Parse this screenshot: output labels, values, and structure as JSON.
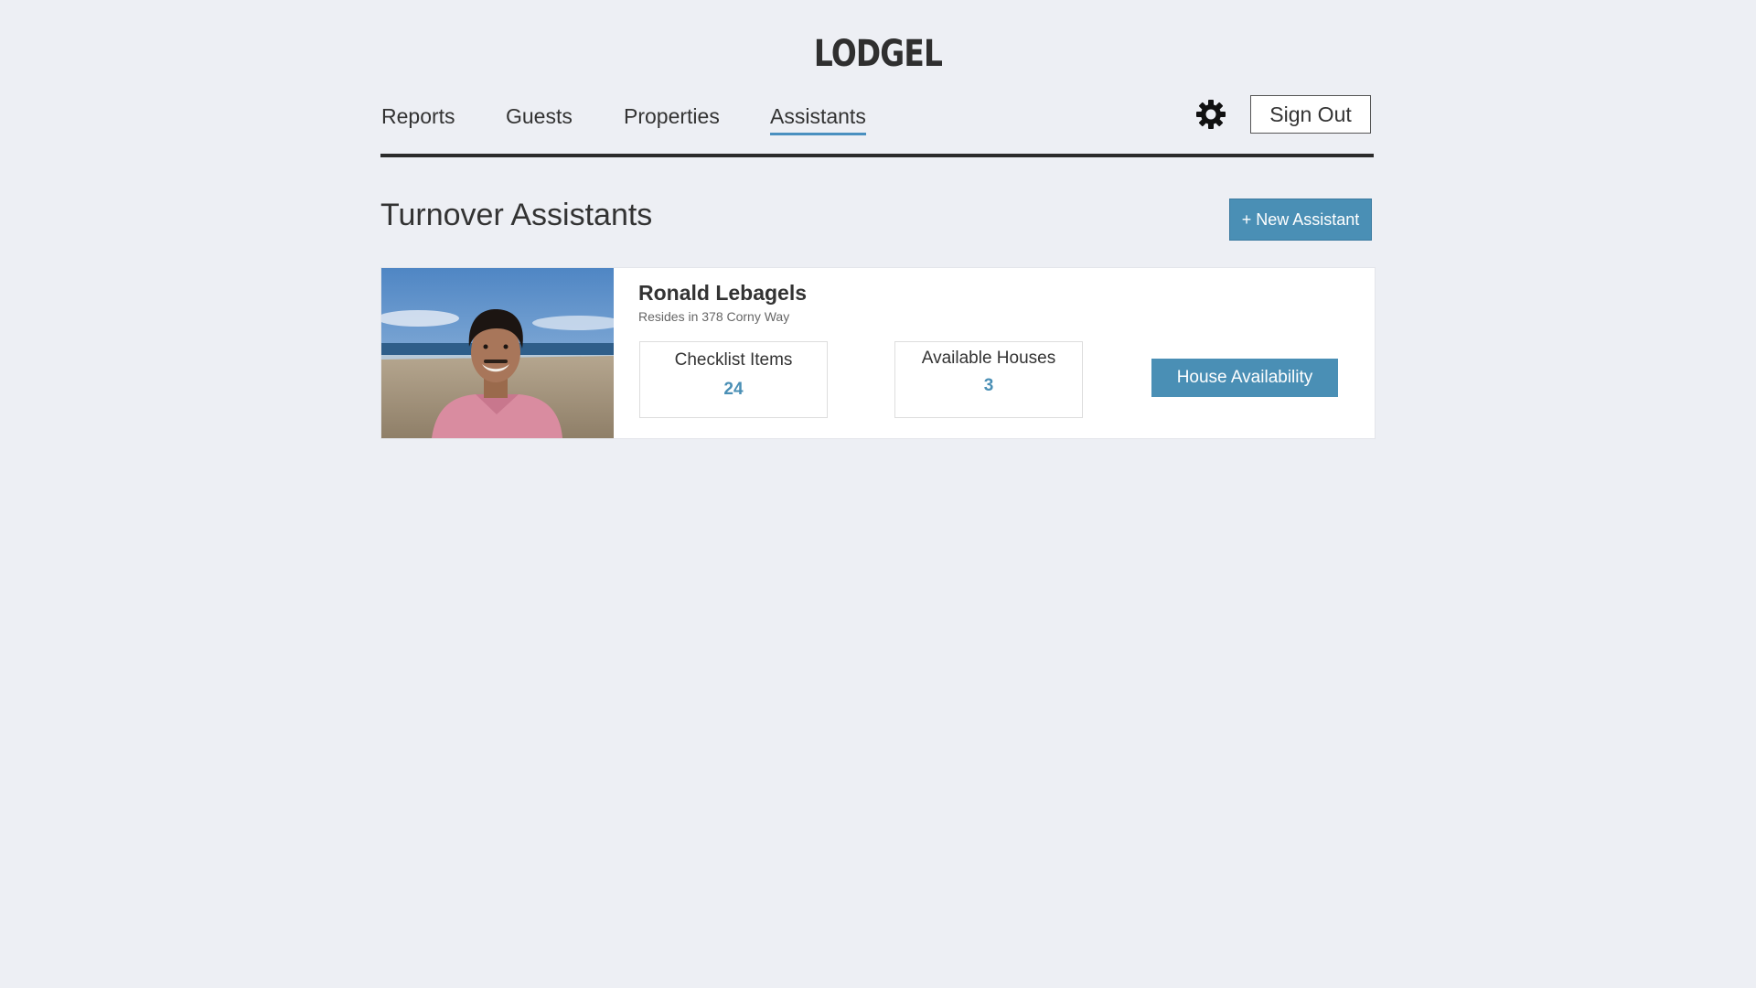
{
  "app": {
    "logo": "LODGEL"
  },
  "nav": {
    "items": [
      {
        "label": "Reports",
        "active": false
      },
      {
        "label": "Guests",
        "active": false
      },
      {
        "label": "Properties",
        "active": false
      },
      {
        "label": "Assistants",
        "active": true
      }
    ],
    "settings_icon": "gear-icon",
    "signout_label": "Sign Out"
  },
  "main": {
    "title": "Turnover Assistants",
    "new_button_label": "+ New Assistant",
    "assistants": [
      {
        "name": "Ronald Lebagels",
        "resides": "Resides in 378 Corny Way",
        "stats": [
          {
            "label": "Checklist Items",
            "value": "24"
          },
          {
            "label": "Available Houses",
            "value": "3"
          }
        ],
        "action_label": "House Availability"
      }
    ]
  },
  "colors": {
    "background": "#edeff4",
    "accent": "#4a8fb5",
    "active_underline": "#4a90c0",
    "text": "#333333"
  }
}
